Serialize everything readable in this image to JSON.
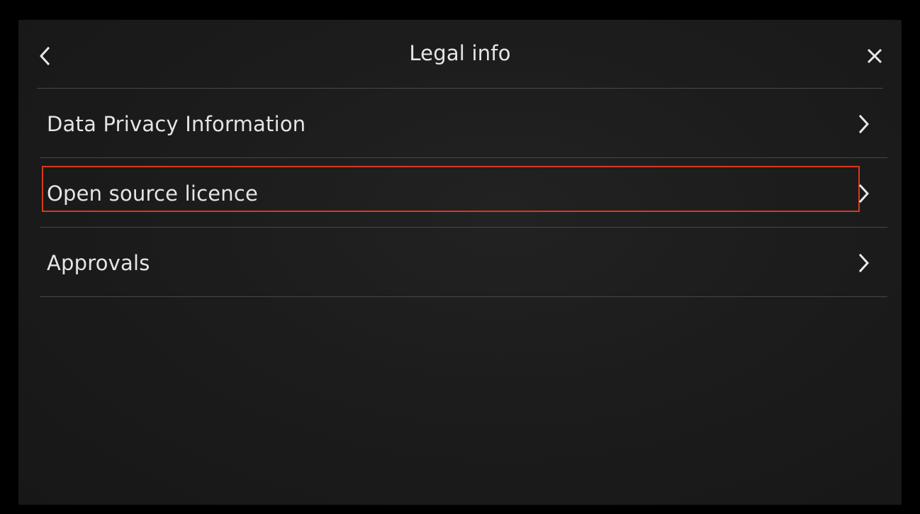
{
  "header": {
    "title": "Legal info",
    "back_icon": "chevron-left-icon",
    "close_icon": "close-icon"
  },
  "menu": {
    "items": [
      {
        "label": "Data Privacy Information",
        "icon": "chevron-right-icon"
      },
      {
        "label": "Open source licence",
        "icon": "chevron-right-icon",
        "highlighted": true
      },
      {
        "label": "Approvals",
        "icon": "chevron-right-icon"
      }
    ]
  },
  "colors": {
    "background": "#000000",
    "panel": "#1c1c1c",
    "text": "#e4e4e4",
    "divider": "#474747",
    "highlight_border": "#d63a1c"
  }
}
